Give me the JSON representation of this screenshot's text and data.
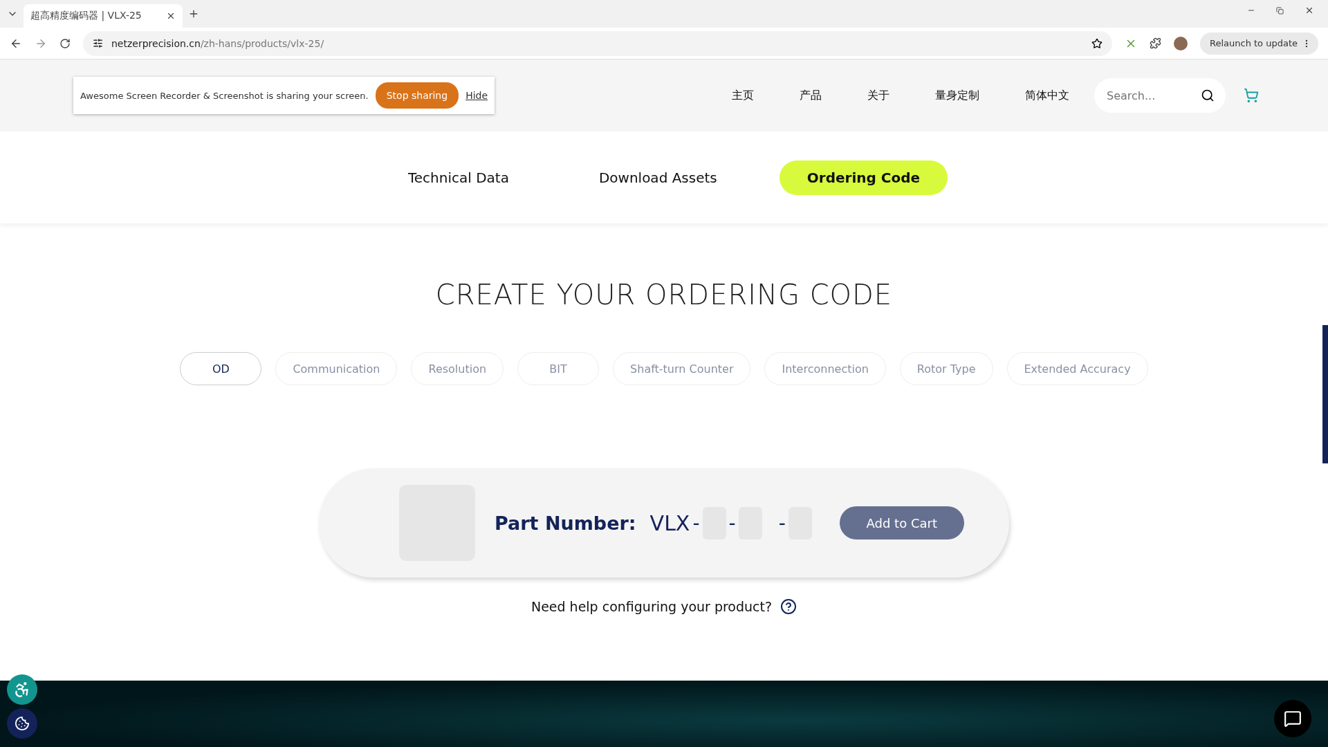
{
  "browser": {
    "tab_title": "超高精度编码器 | VLX-25",
    "url_host": "netzerprecision.cn",
    "url_path": "/zh-hans/products/vlx-25/",
    "relaunch": "Relaunch to update"
  },
  "share_bar": {
    "message": "Awesome Screen Recorder & Screenshot is sharing your screen.",
    "stop": "Stop sharing",
    "hide": "Hide"
  },
  "nav": {
    "items": [
      "主页",
      "产品",
      "关于",
      "量身定制",
      "简体中文"
    ],
    "search": {
      "placeholder": "Search..."
    }
  },
  "section_tabs": [
    {
      "label": "Technical Data",
      "selected": false
    },
    {
      "label": "Download Assets",
      "selected": false
    },
    {
      "label": "Ordering Code",
      "selected": true
    }
  ],
  "heading": "CREATE YOUR ORDERING CODE",
  "options": [
    {
      "label": "OD",
      "selected": true
    },
    {
      "label": "Communication",
      "selected": false
    },
    {
      "label": "Resolution",
      "selected": false
    },
    {
      "label": "BIT",
      "selected": false
    },
    {
      "label": "Shaft-turn Counter",
      "selected": false
    },
    {
      "label": "Interconnection",
      "selected": false
    },
    {
      "label": "Rotor Type",
      "selected": false
    },
    {
      "label": "Extended Accuracy",
      "selected": false
    }
  ],
  "part": {
    "label": "Part Number:",
    "prefix": "VLX",
    "separators": [
      "-",
      "-",
      "-"
    ],
    "button": "Add to Cart"
  },
  "help": "Need help configuring your product?"
}
